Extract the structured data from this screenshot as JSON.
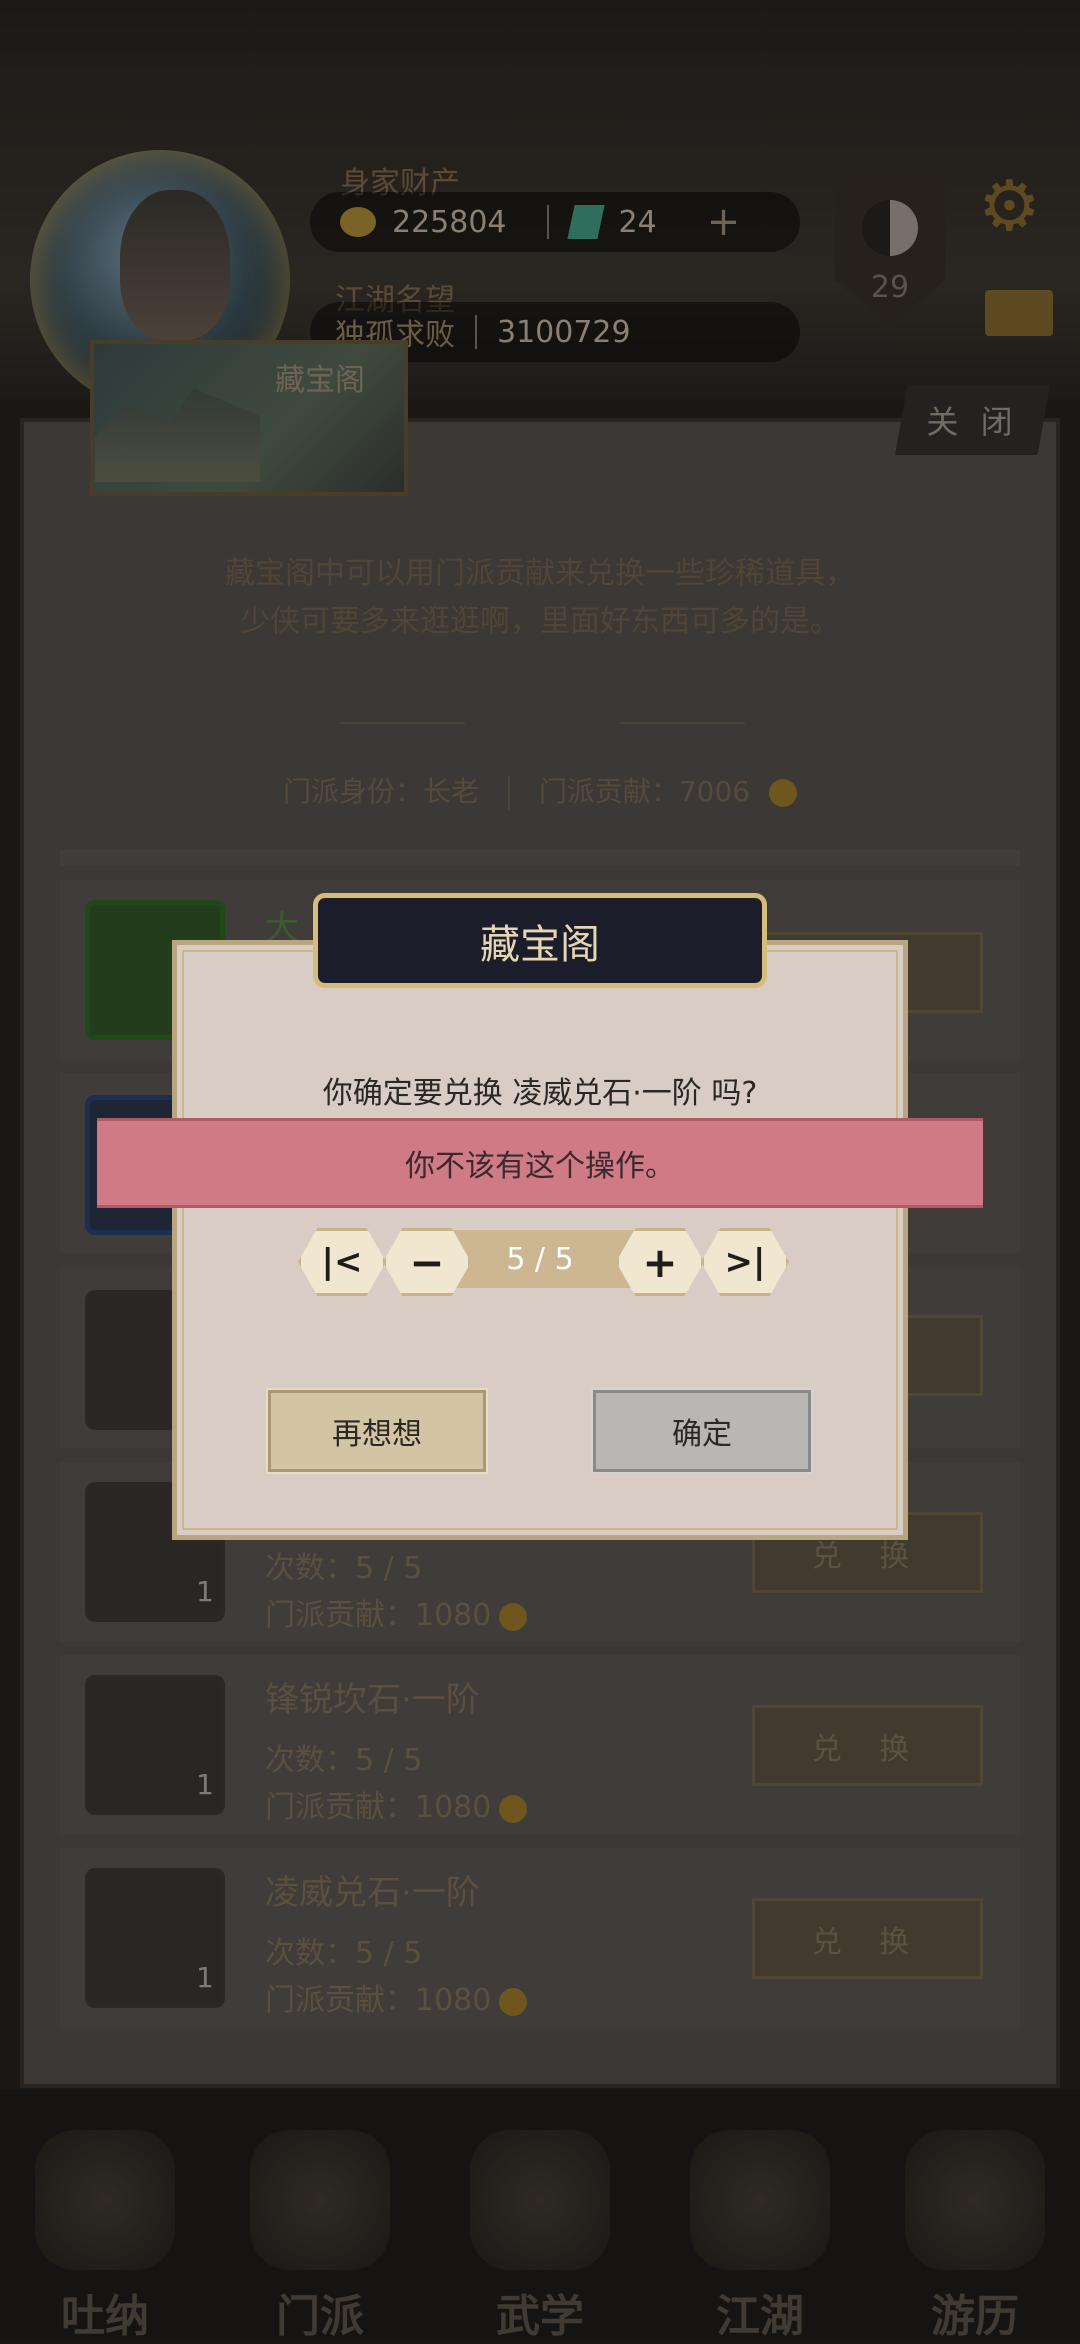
{
  "hud": {
    "assets_label": "身家财产",
    "coins": "225804",
    "gems": "24",
    "reputation_label": "江湖名望",
    "reputation_title": "独孤求败",
    "reputation_value": "3100729",
    "level": "29"
  },
  "panel": {
    "title": "藏宝阁",
    "close_label": "关 闭",
    "intro_line1": "藏宝阁中可以用门派贡献来兑换一些珍稀道具，",
    "intro_line2": "少侠可要多来逛逛啊，里面好东西可多的是。",
    "identity": "门派身份：长老",
    "contribution": "门派贡献：7006"
  },
  "items": [
    {
      "name": "锋锐坎石·一阶",
      "count_label": "次数：5 / 5",
      "cost_label": "门派贡献：1080",
      "qty": "1",
      "button": "兑 换"
    },
    {
      "name": "凌威兑石·一阶",
      "count_label": "次数：5 / 5",
      "cost_label": "门派贡献：1080",
      "qty": "1",
      "button": "兑 换"
    }
  ],
  "partial_items": {
    "row4_count": "次数：5 / 5",
    "row4_cost": "门派贡献：1080",
    "row4_qty": "1",
    "row4_button": "兑 换",
    "row1_name_fragment": "大"
  },
  "dialog": {
    "title": "藏宝阁",
    "question": "你确定要兑换 凌威兑石·一阶 吗?",
    "toast": "你不该有这个操作。",
    "stepper_value": "5 / 5",
    "cancel_label": "再想想",
    "confirm_label": "确定"
  },
  "nav": [
    {
      "label": "吐纳"
    },
    {
      "label": "门派"
    },
    {
      "label": "武学"
    },
    {
      "label": "江湖"
    },
    {
      "label": "游历"
    }
  ]
}
